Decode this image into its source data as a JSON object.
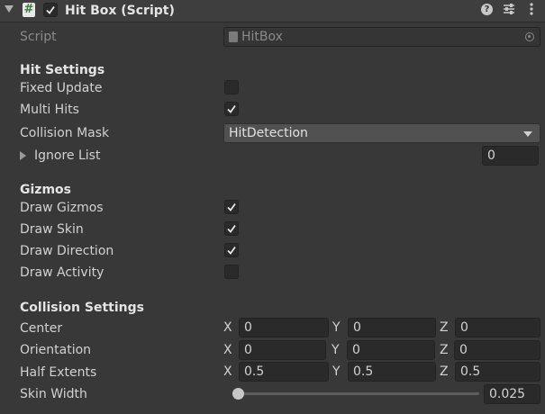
{
  "header": {
    "title": "Hit Box (Script)",
    "enabled": true
  },
  "script_row": {
    "label": "Script",
    "value": "HitBox"
  },
  "hit_settings": {
    "title": "Hit Settings",
    "fixed_update": {
      "label": "Fixed Update",
      "checked": false
    },
    "multi_hits": {
      "label": "Multi Hits",
      "checked": true
    },
    "collision_mask": {
      "label": "Collision Mask",
      "value": "HitDetection"
    },
    "ignore_list": {
      "label": "Ignore List",
      "count": "0"
    }
  },
  "gizmos": {
    "title": "Gizmos",
    "draw_gizmos": {
      "label": "Draw Gizmos",
      "checked": true
    },
    "draw_skin": {
      "label": "Draw Skin",
      "checked": true
    },
    "draw_direction": {
      "label": "Draw Direction",
      "checked": true
    },
    "draw_activity": {
      "label": "Draw Activity",
      "checked": false
    }
  },
  "collision_settings": {
    "title": "Collision Settings",
    "axes": {
      "x": "X",
      "y": "Y",
      "z": "Z"
    },
    "center": {
      "label": "Center",
      "x": "0",
      "y": "0",
      "z": "0"
    },
    "orientation": {
      "label": "Orientation",
      "x": "0",
      "y": "0",
      "z": "0"
    },
    "half_extents": {
      "label": "Half Extents",
      "x": "0.5",
      "y": "0.5",
      "z": "0.5"
    },
    "skin_width": {
      "label": "Skin Width",
      "value": "0.025",
      "slider_fraction": 0.025
    }
  },
  "colors": {
    "background": "#383838",
    "field": "#2a2a2a",
    "dropdown": "#515151"
  }
}
